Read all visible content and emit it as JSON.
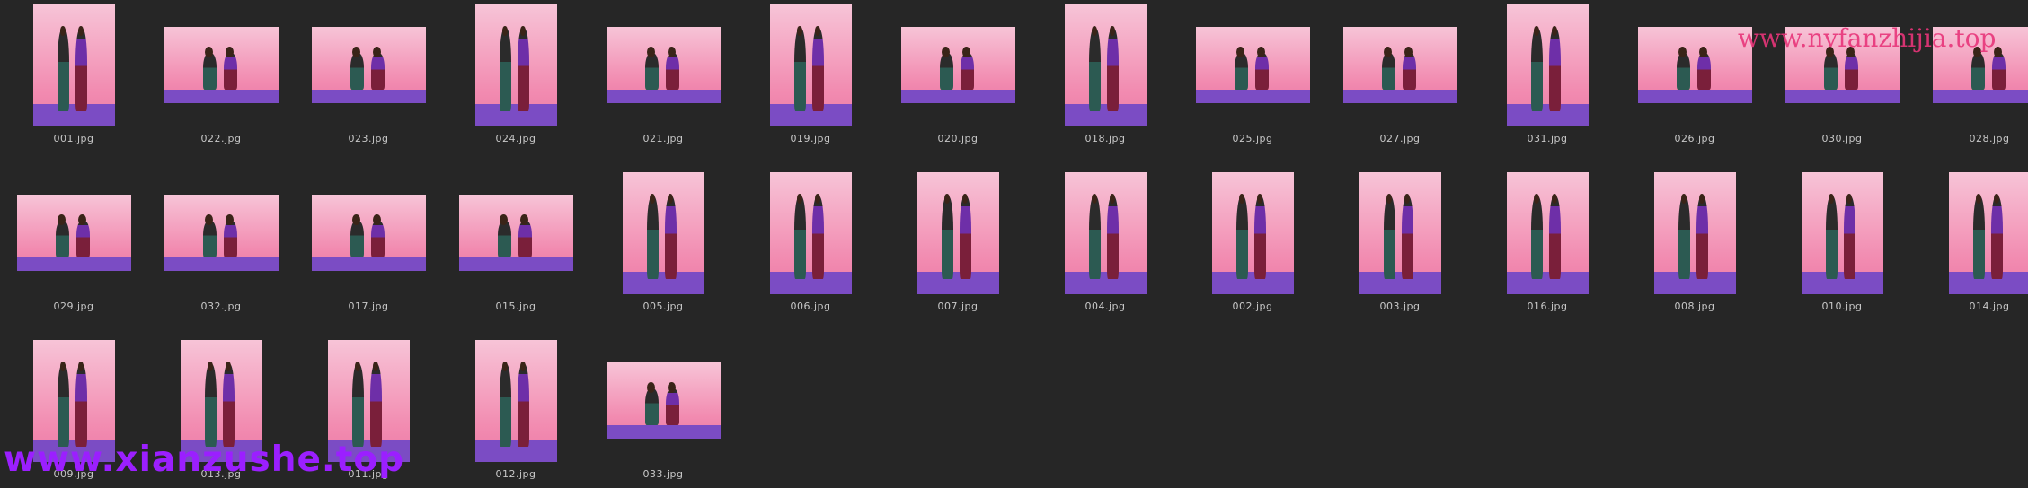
{
  "viewer": {
    "background_color": "#262626",
    "thumbnails": [
      {
        "label": "001.jpg",
        "orientation": "portrait"
      },
      {
        "label": "022.jpg",
        "orientation": "landscape"
      },
      {
        "label": "023.jpg",
        "orientation": "landscape"
      },
      {
        "label": "024.jpg",
        "orientation": "portrait"
      },
      {
        "label": "021.jpg",
        "orientation": "landscape"
      },
      {
        "label": "019.jpg",
        "orientation": "portrait"
      },
      {
        "label": "020.jpg",
        "orientation": "landscape"
      },
      {
        "label": "018.jpg",
        "orientation": "portrait"
      },
      {
        "label": "025.jpg",
        "orientation": "landscape"
      },
      {
        "label": "027.jpg",
        "orientation": "landscape"
      },
      {
        "label": "031.jpg",
        "orientation": "portrait"
      },
      {
        "label": "026.jpg",
        "orientation": "landscape"
      },
      {
        "label": "030.jpg",
        "orientation": "landscape"
      },
      {
        "label": "028.jpg",
        "orientation": "landscape"
      },
      {
        "label": "029.jpg",
        "orientation": "landscape"
      },
      {
        "label": "032.jpg",
        "orientation": "landscape"
      },
      {
        "label": "017.jpg",
        "orientation": "landscape"
      },
      {
        "label": "015.jpg",
        "orientation": "landscape"
      },
      {
        "label": "005.jpg",
        "orientation": "portrait"
      },
      {
        "label": "006.jpg",
        "orientation": "portrait"
      },
      {
        "label": "007.jpg",
        "orientation": "portrait"
      },
      {
        "label": "004.jpg",
        "orientation": "portrait"
      },
      {
        "label": "002.jpg",
        "orientation": "portrait"
      },
      {
        "label": "003.jpg",
        "orientation": "portrait"
      },
      {
        "label": "016.jpg",
        "orientation": "portrait"
      },
      {
        "label": "008.jpg",
        "orientation": "portrait"
      },
      {
        "label": "010.jpg",
        "orientation": "portrait"
      },
      {
        "label": "014.jpg",
        "orientation": "portrait"
      },
      {
        "label": "009.jpg",
        "orientation": "portrait"
      },
      {
        "label": "013.jpg",
        "orientation": "portrait"
      },
      {
        "label": "011.jpg",
        "orientation": "portrait"
      },
      {
        "label": "012.jpg",
        "orientation": "portrait"
      },
      {
        "label": "033.jpg",
        "orientation": "landscape"
      }
    ]
  },
  "watermarks": {
    "top_right": "www.nvfanzhijia.top",
    "bottom_left": "www.xianzushe.top",
    "top_right_color": "#e8357a",
    "bottom_left_color": "#9b1fff"
  }
}
